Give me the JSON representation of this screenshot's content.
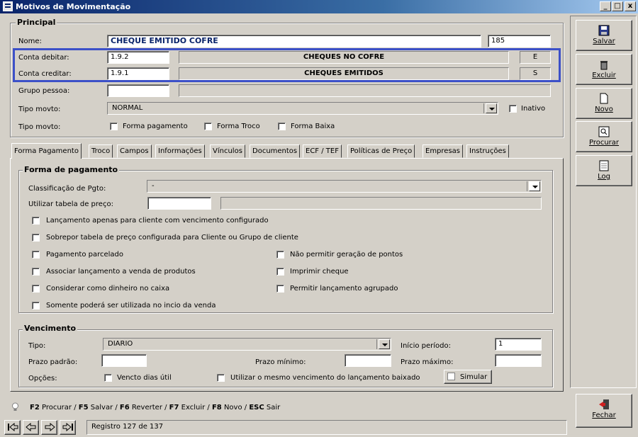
{
  "window": {
    "title": "Motivos de Movimentação",
    "controls": [
      "_",
      "□",
      "x"
    ]
  },
  "principal": {
    "legend": "Principal",
    "nome_label": "Nome:",
    "nome_value": "CHEQUE EMITIDO COFRE",
    "codigo_value": "185",
    "conta_debitar_label": "Conta debitar:",
    "conta_debitar_code": "1.9.2",
    "conta_debitar_desc": "CHEQUES NO COFRE",
    "conta_debitar_type": "E",
    "conta_creditar_label": "Conta creditar:",
    "conta_creditar_code": "1.9.1",
    "conta_creditar_desc": "CHEQUES EMITIDOS",
    "conta_creditar_type": "S",
    "grupo_pessoa_label": "Grupo pessoa:",
    "tipo_movto_label": "Tipo movto:",
    "tipo_movto_value": "NORMAL",
    "inativo_label": "Inativo",
    "tipo_movto2_label": "Tipo movto:",
    "forma_pagamento_label": "Forma pagamento",
    "forma_troco_label": "Forma Troco",
    "forma_baixa_label": "Forma Baixa"
  },
  "tabs": [
    "Forma Pagamento",
    "Troco",
    "Campos",
    "Informações",
    "Vínculos",
    "Documentos",
    "ECF / TEF",
    "Políticas de Preço",
    "Empresas",
    "Instruções"
  ],
  "forma_pagamento": {
    "legend": "Forma de pagamento",
    "classificacao_label": "Classificação de Pgto:",
    "classificacao_value": "-",
    "tabela_preco_label": "Utilizar tabela de preço:",
    "checks": {
      "lancamento_vencimento": "Lançamento apenas para cliente com vencimento configurado",
      "sobrepor_tabela": "Sobrepor tabela de preço configurada para Cliente ou Grupo de cliente",
      "pagamento_parcelado": "Pagamento parcelado",
      "nao_permitir_pontos": "Não permitir geração de pontos",
      "associar_lancamento": "Associar lançamento a venda de produtos",
      "imprimir_cheque": "Imprimir cheque",
      "considerar_dinheiro": "Considerar como dinheiro no caixa",
      "permitir_agrupado": "Permitir lançamento agrupado",
      "somente_inicio": "Somente poderá ser utilizada no incio da venda"
    }
  },
  "vencimento": {
    "legend": "Vencimento",
    "tipo_label": "Tipo:",
    "tipo_value": "DIARIO",
    "inicio_periodo_label": "Início período:",
    "inicio_periodo_value": "1",
    "prazo_padrao_label": "Prazo padrão:",
    "prazo_minimo_label": "Prazo mínimo:",
    "prazo_maximo_label": "Prazo máximo:",
    "opcoes_label": "Opções:",
    "vencto_dias_util_label": "Vencto dias útil",
    "mesmo_vencimento_label": "Utilizar o mesmo vencimento do lançamento baixado",
    "simular_label": "Simular"
  },
  "toolbar": {
    "salvar": "Salvar",
    "excluir": "Excluir",
    "novo": "Novo",
    "procurar": "Procurar",
    "log": "Log",
    "fechar": "Fechar"
  },
  "shortcuts": {
    "f2_key": "F2",
    "f2_text": "Procurar /",
    "f5_key": "F5",
    "f5_text": "Salvar /",
    "f6_key": "F6",
    "f6_text": "Reverter /",
    "f7_key": "F7",
    "f7_text": "Excluir /",
    "f8_key": "F8",
    "f8_text": "Novo /",
    "esc_key": "ESC",
    "esc_text": "Sair"
  },
  "status": {
    "record": "Registro 127 de 137"
  },
  "colors": {
    "highlight": "#3c50c8",
    "title_bar": "#0a246a",
    "window_bg": "#d4d0c8"
  }
}
